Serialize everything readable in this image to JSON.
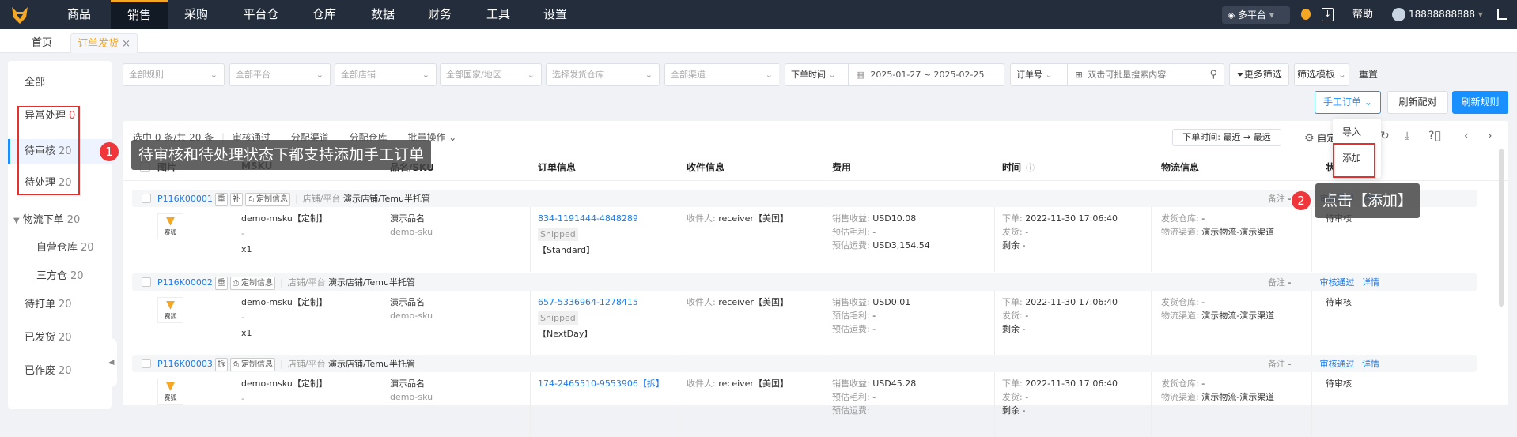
{
  "nav": {
    "items": [
      "商品",
      "销售",
      "采购",
      "平台仓",
      "仓库",
      "数据",
      "财务",
      "工具",
      "设置"
    ],
    "active": 1,
    "platform": "多平台",
    "help": "帮助",
    "user": "18888888888"
  },
  "tabs": [
    {
      "label": "首页"
    },
    {
      "label": "订单发货",
      "close": "×"
    }
  ],
  "sidebar": [
    {
      "label": "全部",
      "count": ""
    },
    {
      "label": "异常处理",
      "count": "0"
    },
    {
      "label": "待审核",
      "count": "20"
    },
    {
      "label": "待处理",
      "count": "20"
    },
    {
      "label": "物流下单",
      "count": "20"
    },
    {
      "label": "自营仓库",
      "count": "20"
    },
    {
      "label": "三方仓",
      "count": "20"
    },
    {
      "label": "待打单",
      "count": "20"
    },
    {
      "label": "已发货",
      "count": "20"
    },
    {
      "label": "已作废",
      "count": "20"
    }
  ],
  "filters": {
    "rule": "全部规则",
    "platform": "全部平台",
    "shop": "全部店铺",
    "country": "全部国家/地区",
    "warehouse": "选择发货仓库",
    "channel": "全部渠道",
    "time_type": "下单时间",
    "date_range": "2025-01-27 ~ 2025-02-25",
    "search_type": "订单号",
    "search_placeholder": "双击可批量搜索内容",
    "more": "更多筛选",
    "template": "筛选模板",
    "reset": "重置"
  },
  "actions": {
    "manual": "手工订单",
    "refresh_pair": "刷新配对",
    "refresh_rule": "刷新规则",
    "menu": [
      "导入",
      "添加"
    ]
  },
  "toolbar": {
    "selected": "选中 0 条/共 20 条",
    "approve": "审核通过",
    "assign_channel": "分配渠道",
    "assign_wh": "分配仓库",
    "batch": "批量操作",
    "sort": "下单时间:  最近 → 最远",
    "custom": "自定义"
  },
  "columns": [
    "图片",
    "MSKU",
    "品名/SKU",
    "订单信息",
    "收件信息",
    "费用",
    "时间",
    "物流信息",
    "状态"
  ],
  "labels": {
    "shop": "店铺/平台",
    "custom_info": "定制信息",
    "receiver": "收件人:",
    "sales": "销售收益:",
    "profit": "预估毛利:",
    "freight": "预估运费:",
    "order_time": "下单:",
    "ship_time": "发货:",
    "remain": "剩余 -",
    "ship_wh": "发货仓库:",
    "channel": "物流渠道:",
    "remark": "备注",
    "approve": "审核通过",
    "detail": "详情",
    "logo": "赛狐"
  },
  "orders": [
    {
      "id": "P116K00001",
      "tags": [
        "重",
        "补"
      ],
      "shop": "演示店铺/Temu半托管",
      "msku": "demo-msku【定制】",
      "msku2": "-",
      "qty": "x1",
      "name": "演示品名",
      "sku": "demo-sku",
      "order_no": "834-1191444-4848289",
      "ship_status": "Shipped",
      "ship_type": "【Standard】",
      "receiver": "receiver【美国】",
      "sales": "USD10.08",
      "profit": "-",
      "freight": "USD3,154.54",
      "time": "2022-11-30 17:06:40",
      "ship": "-",
      "wh": "-",
      "channel": "演示物流-演示渠道",
      "status": "待审核",
      "remark": "-"
    },
    {
      "id": "P116K00002",
      "tags": [
        "重"
      ],
      "shop": "演示店铺/Temu半托管",
      "msku": "demo-msku【定制】",
      "msku2": "-",
      "qty": "x1",
      "name": "演示品名",
      "sku": "demo-sku",
      "order_no": "657-5336964-1278415",
      "ship_status": "Shipped",
      "ship_type": "【NextDay】",
      "receiver": "receiver【美国】",
      "sales": "USD0.01",
      "profit": "-",
      "freight": "-",
      "time": "2022-11-30 17:06:40",
      "ship": "-",
      "wh": "-",
      "channel": "演示物流-演示渠道",
      "status": "待审核",
      "remark": "-"
    },
    {
      "id": "P116K00003",
      "tags": [
        "拆"
      ],
      "shop": "演示店铺/Temu半托管",
      "msku": "demo-msku【定制】",
      "msku2": "-",
      "qty": "",
      "name": "演示品名",
      "sku": "demo-sku",
      "order_no": "174-2465510-9553906【拆】",
      "ship_status": "",
      "ship_type": "",
      "receiver": "receiver【美国】",
      "sales": "USD45.28",
      "profit": "-",
      "freight": "",
      "time": "2022-11-30 17:06:40",
      "ship": "-",
      "wh": "-",
      "channel": "演示物流-演示渠道",
      "status": "待审核",
      "remark": "-"
    }
  ],
  "tips": [
    {
      "num": "1",
      "text": "待审核和待处理状态下都支持添加手工订单"
    },
    {
      "num": "2",
      "text": "点击【添加】"
    }
  ],
  "colors": {
    "nav": "#232d3b",
    "accent": "#f5a623",
    "primary": "#1890ff",
    "highlight": "#e53030"
  }
}
